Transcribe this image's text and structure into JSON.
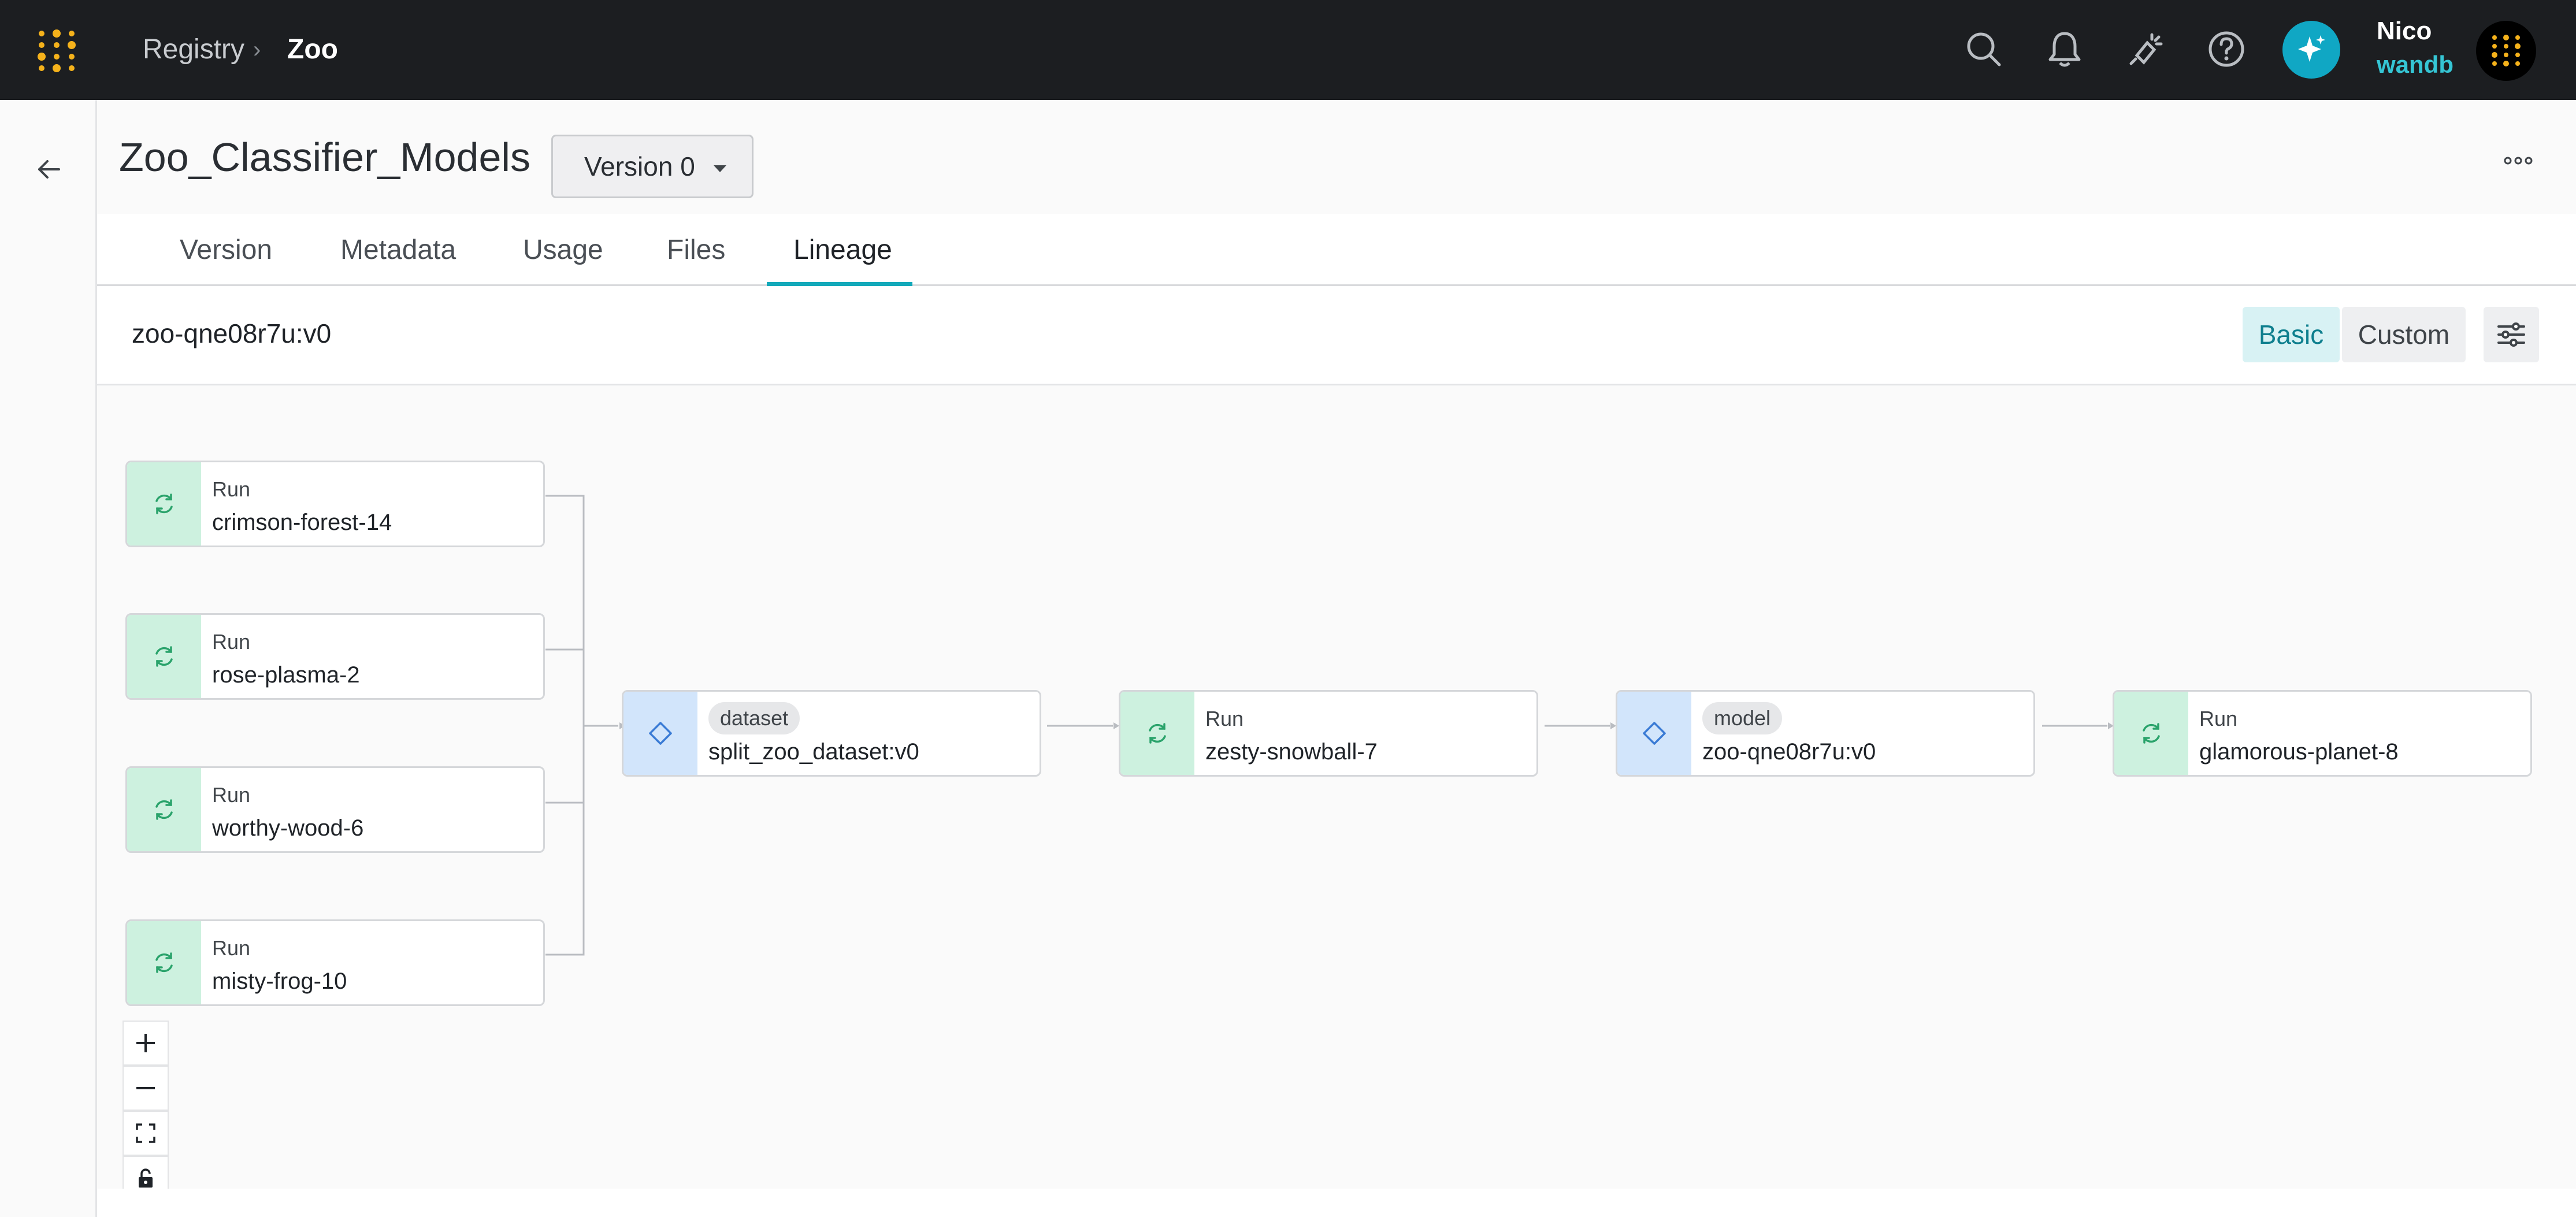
{
  "topbar": {
    "breadcrumb": [
      "Registry",
      "Zoo"
    ],
    "icons": [
      "search-icon",
      "bell-icon",
      "lightbulb-icon",
      "help-icon",
      "sparkle-icon"
    ],
    "user": {
      "name": "Nico",
      "org": "wandb"
    }
  },
  "header": {
    "title": "Zoo_Classifier_Models",
    "version_select": "Version 0"
  },
  "tabs": [
    {
      "label": "Version"
    },
    {
      "label": "Metadata"
    },
    {
      "label": "Usage"
    },
    {
      "label": "Files"
    },
    {
      "label": "Lineage",
      "active": true
    }
  ],
  "lineage": {
    "artifact_label": "zoo-qne08r7u:v0",
    "mode_buttons": [
      "Basic",
      "Custom"
    ],
    "active_mode": "Basic"
  },
  "nodes": [
    {
      "kind": "run",
      "type": "Run",
      "name": "crimson-forest-14"
    },
    {
      "kind": "run",
      "type": "Run",
      "name": "rose-plasma-2"
    },
    {
      "kind": "run",
      "type": "Run",
      "name": "worthy-wood-6"
    },
    {
      "kind": "run",
      "type": "Run",
      "name": "misty-frog-10"
    },
    {
      "kind": "artifact",
      "type": "dataset",
      "name": "split_zoo_dataset:v0"
    },
    {
      "kind": "run",
      "type": "Run",
      "name": "zesty-snowball-7"
    },
    {
      "kind": "artifact",
      "type": "model",
      "name": "zoo-qne08r7u:v0"
    },
    {
      "kind": "run",
      "type": "Run",
      "name": "glamorous-planet-8"
    }
  ],
  "zoom_controls": [
    "plus-icon",
    "minus-icon",
    "fit-view-icon",
    "lock-icon"
  ],
  "colors": {
    "topbar_bg": "#1c1e21",
    "accent": "#13a9ba",
    "run_icon_bg": "#cdf1df",
    "artifact_icon_bg": "#d2e5fb",
    "brand_dots": "#f5b21b"
  }
}
